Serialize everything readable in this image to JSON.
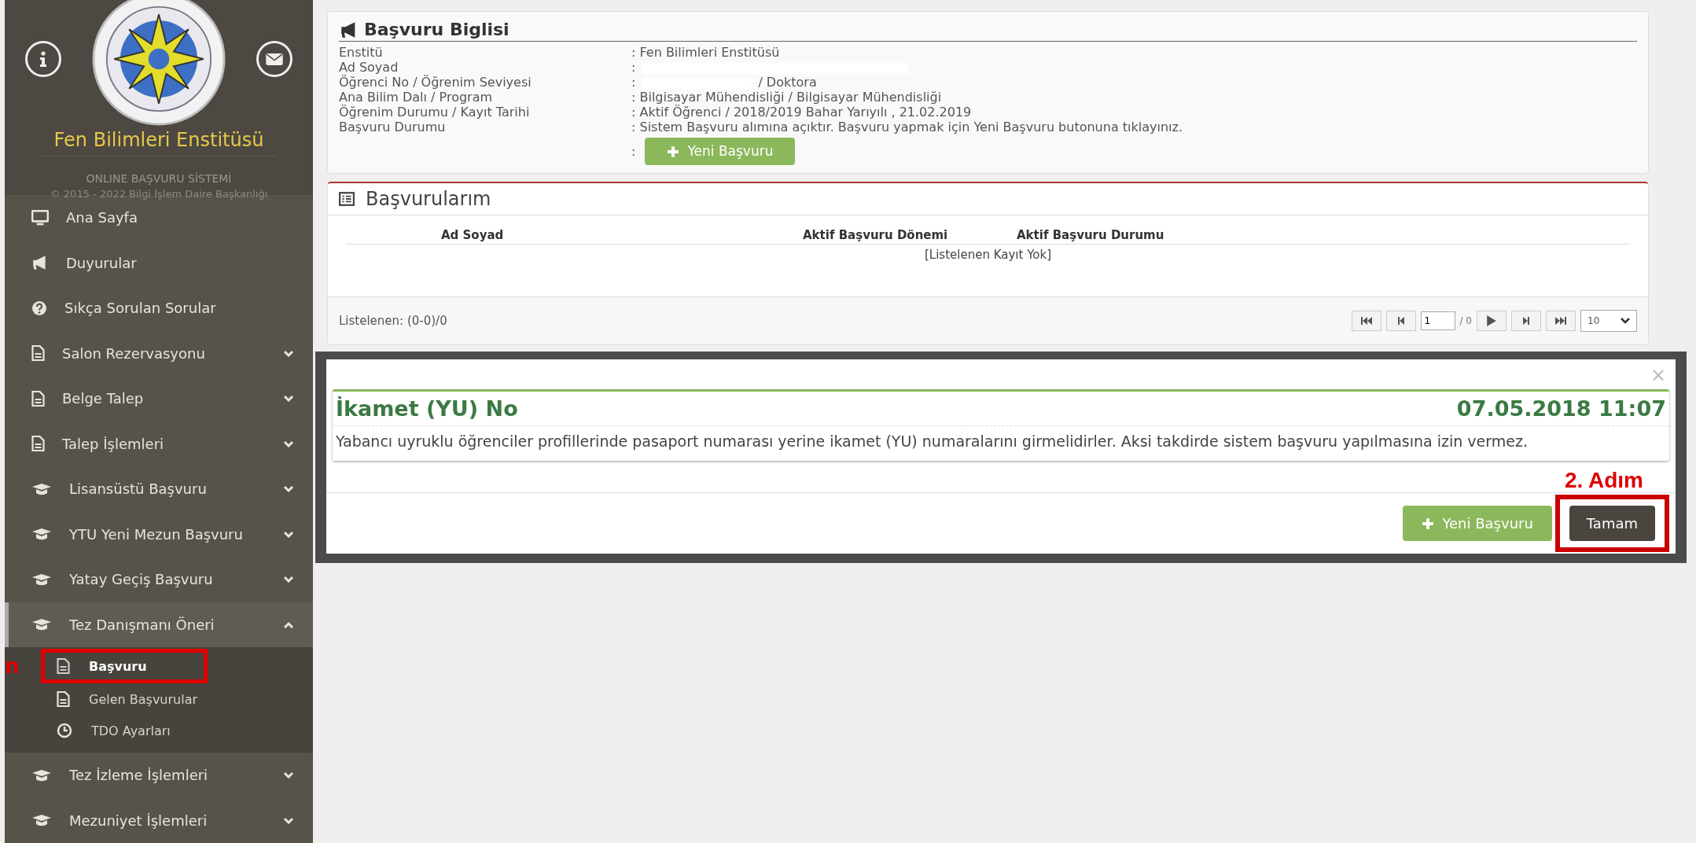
{
  "sidebar": {
    "title": "Fen Bilimleri Enstitüsü",
    "subtitle": "ONLINE BAŞVURU SİSTEMİ",
    "copyright": "© 2015 - 2022 Bilgi İşlem Daire Başkanlığı",
    "items": [
      {
        "label": "Ana Sayfa",
        "kind": "monitor",
        "expandable": false
      },
      {
        "label": "Duyurular",
        "kind": "megaphone",
        "expandable": false
      },
      {
        "label": "Sıkça Sorulan Sorular",
        "kind": "question",
        "expandable": false
      },
      {
        "label": "Salon Rezervasyonu",
        "kind": "file",
        "expandable": true,
        "expanded": false
      },
      {
        "label": "Belge Talep",
        "kind": "file",
        "expandable": true,
        "expanded": false
      },
      {
        "label": "Talep İşlemleri",
        "kind": "file",
        "expandable": true,
        "expanded": false
      },
      {
        "label": "Lisansüstü Başvuru",
        "kind": "cap",
        "expandable": true,
        "expanded": false
      },
      {
        "label": "YTU Yeni Mezun Başvuru",
        "kind": "cap",
        "expandable": true,
        "expanded": false
      },
      {
        "label": "Yatay Geçiş Başvuru",
        "kind": "cap",
        "expandable": true,
        "expanded": false
      },
      {
        "label": "Tez Danışmanı Öneri",
        "kind": "cap",
        "expandable": true,
        "expanded": true,
        "children": [
          {
            "label": "Başvuru",
            "kind": "file",
            "selected": true,
            "highlighted": true
          },
          {
            "label": "Gelen Başvurular",
            "kind": "file",
            "selected": false,
            "highlighted": false
          },
          {
            "label": "TDO Ayarları",
            "kind": "clock",
            "selected": false,
            "highlighted": false
          }
        ]
      },
      {
        "label": "Tez İzleme İşlemleri",
        "kind": "cap",
        "expandable": true,
        "expanded": false
      },
      {
        "label": "Mezuniyet İşlemleri",
        "kind": "cap",
        "expandable": true,
        "expanded": false
      }
    ],
    "annotation": "n"
  },
  "info_panel": {
    "title": "Başvuru Biglisi",
    "rows": [
      {
        "kind": "text",
        "label": "Enstitü",
        "value": ": Fen Bilimleri Enstitüsü",
        "redacted": false
      },
      {
        "kind": "text",
        "label": "Ad Soyad",
        "value": ":",
        "redacted": true
      },
      {
        "kind": "text",
        "label": "Öğrenci No / Öğrenim Seviyesi",
        "value": ":",
        "redacted": true,
        "suffix": "/ Doktora"
      },
      {
        "kind": "text",
        "label": "Ana Bilim Dalı / Program",
        "value": ": Bilgisayar Mühendisliği / Bilgisayar Mühendisliği",
        "redacted": false
      },
      {
        "kind": "text",
        "label": "Öğrenim Durumu / Kayıt Tarihi",
        "value": ": Aktif Öğrenci / 2018/2019 Bahar Yarıyılı , 21.02.2019",
        "redacted": false
      },
      {
        "kind": "text",
        "label": "Başvuru Durumu",
        "value": ": Sistem Başvuru alımına açıktır. Başvuru yapmak için Yeni Başvuru butonuna tıklayınız.",
        "redacted": false
      },
      {
        "kind": "button",
        "value": ":",
        "button": "Yeni Başvuru"
      }
    ]
  },
  "applications": {
    "title": "Başvurularım",
    "columns": [
      "Ad Soyad",
      "Aktif Başvuru Dönemi",
      "Aktif Başvuru Durumu"
    ],
    "empty_message": "[Listelenen Kayıt Yok]",
    "footer": "Listelenen: (0-0)/0",
    "pager": {
      "page": "1",
      "total": "/ 0",
      "page_size": "10"
    }
  },
  "modal": {
    "close": "×",
    "title": "İkamet (YU) No",
    "date": "07.05.2018 11:07",
    "body": "Yabancı uyruklu öğrenciler profillerinde pasaport numarası yerine ikamet (YU) numaralarını girmelidirler. Aksi takdirde sistem başvuru yapılmasına izin vermez.",
    "buttons": [
      {
        "label": "Yeni Başvuru",
        "kind": "add",
        "highlighted": false
      },
      {
        "label": "Tamam",
        "kind": "close",
        "highlighted": true
      }
    ],
    "annotation": "2. Adım"
  }
}
